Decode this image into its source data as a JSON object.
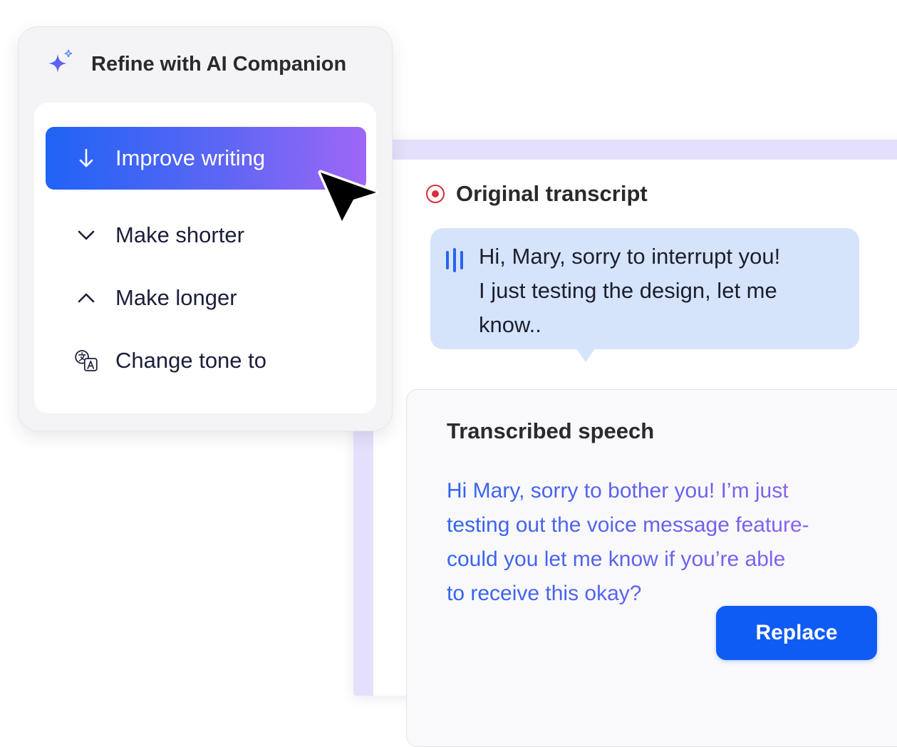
{
  "ai_panel": {
    "title": "Refine with AI Companion",
    "menu": [
      {
        "label": "Improve writing",
        "icon": "arrow-down-icon",
        "active": true
      },
      {
        "label": "Make shorter",
        "icon": "chevron-down-icon",
        "active": false
      },
      {
        "label": "Make longer",
        "icon": "chevron-up-icon",
        "active": false
      },
      {
        "label": "Change tone to",
        "icon": "translate-icon",
        "active": false
      }
    ]
  },
  "transcript": {
    "original_title": "Original transcript",
    "original_lines": [
      "Hi, Mary, sorry to interrupt you!",
      "I just testing the design, let me",
      "know.."
    ],
    "speech_title": "Transcribed speech",
    "speech_lines": [
      "Hi Mary, sorry to bother you! I’m just",
      "testing out the voice message feature-",
      "could you let me know if you’re able",
      "to receive this okay?"
    ],
    "replace_label": "Replace"
  },
  "colors": {
    "accent_blue": "#0f5cf5",
    "gradient_end_purple": "#9f66f6",
    "record_red": "#d92d3d",
    "bubble_bg": "#d6e4fb",
    "panel_border_lavender": "#e4e0fb"
  }
}
